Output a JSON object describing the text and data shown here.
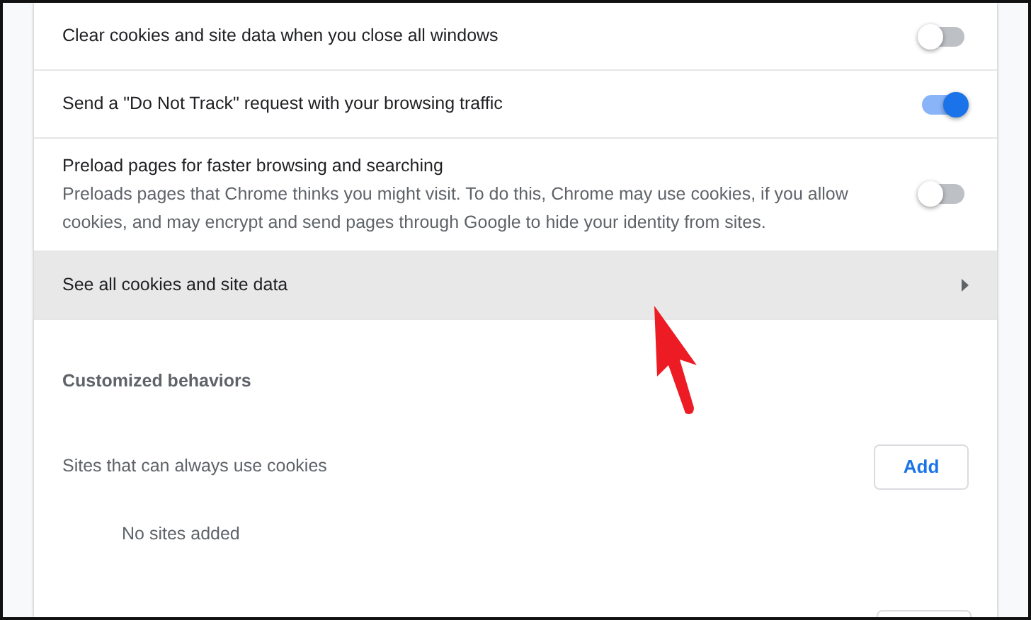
{
  "settings": [
    {
      "kind": "toggle",
      "label": "Clear cookies and site data when you close all windows",
      "on": false
    },
    {
      "kind": "toggle",
      "label": "Send a \"Do Not Track\" request with your browsing traffic",
      "on": true
    },
    {
      "kind": "toggle",
      "label": "Preload pages for faster browsing and searching",
      "description": "Preloads pages that Chrome thinks you might visit. To do this, Chrome may use cookies, if you allow cookies, and may encrypt and send pages through Google to hide your identity from sites.",
      "on": false
    },
    {
      "kind": "link",
      "label": "See all cookies and site data",
      "hovered": true
    }
  ],
  "section": {
    "heading": "Customized behaviors",
    "groups": [
      {
        "label": "Sites that can always use cookies",
        "button": "Add",
        "empty_text": "No sites added"
      }
    ]
  }
}
